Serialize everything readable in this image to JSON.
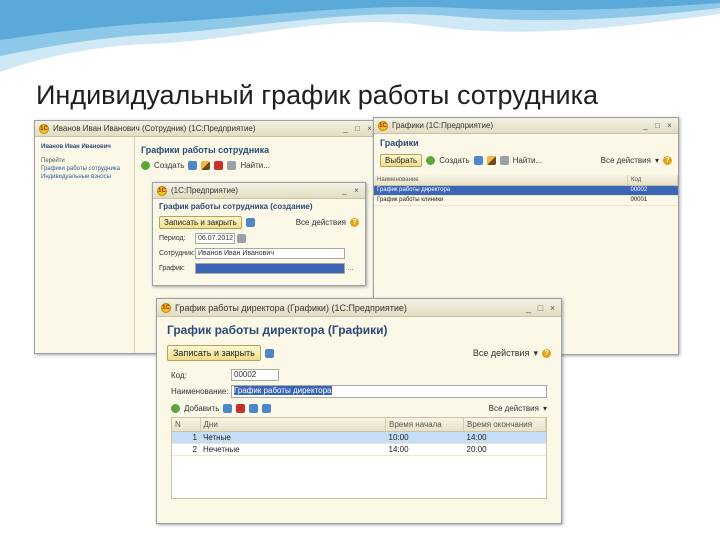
{
  "slide": {
    "title": "Индивидуальный график работы сотрудника"
  },
  "colors": {
    "wave": "#8ec8e8",
    "accent": "#2b4a7a",
    "selection": "#c6ddf7"
  },
  "win_back_left": {
    "titlebar": "Иванов Иван Иванович (Сотрудник) (1С:Предприятие)",
    "sidebar_title": "Иванов Иван Иванович",
    "sidebar_head": "Перейти",
    "links": [
      "Графики работы сотрудника",
      "Индивидуальные взносы"
    ],
    "form_title": "Графики работы сотрудника",
    "toolbar_create": "Создать",
    "toolbar_find": "Найти...",
    "toolbar_actions": "Все действия"
  },
  "win_back_right": {
    "titlebar": "Графики (1С:Предприятие)",
    "form_title": "Графики",
    "select_btn": "Выбрать",
    "create": "Создать",
    "find": "Найти...",
    "actions": "Все действия",
    "col_name": "Наименование",
    "col_code": "Код",
    "rows": [
      {
        "name": "График работы директора",
        "code": "00002"
      },
      {
        "name": "График работы клиники",
        "code": "00001"
      }
    ]
  },
  "win_mid": {
    "titlebar": "(1С:Предприятие)",
    "form_title": "График работы сотрудника (создание)",
    "save_close": "Записать и закрыть",
    "actions": "Все действия",
    "period_label": "Период:",
    "period_value": "06.07.2012",
    "employee_label": "Сотрудник:",
    "employee_value": "Иванов Иван Иванович",
    "schedule_label": "График:"
  },
  "win_front": {
    "titlebar": "График работы директора (Графики) (1С:Предприятие)",
    "form_title": "График работы директора (Графики)",
    "save_close": "Записать и закрыть",
    "actions": "Все действия",
    "code_label": "Код:",
    "code_value": "00002",
    "name_label": "Наименование:",
    "name_value": "График работы директора",
    "add_label": "Добавить",
    "table_actions": "Все действия",
    "columns": [
      "N",
      "Дни",
      "Время начала",
      "Время окончания"
    ],
    "rows": [
      {
        "n": "1",
        "days": "Четные",
        "start": "10:00",
        "end": "14:00"
      },
      {
        "n": "2",
        "days": "Нечетные",
        "start": "14:00",
        "end": "20:00"
      }
    ]
  }
}
